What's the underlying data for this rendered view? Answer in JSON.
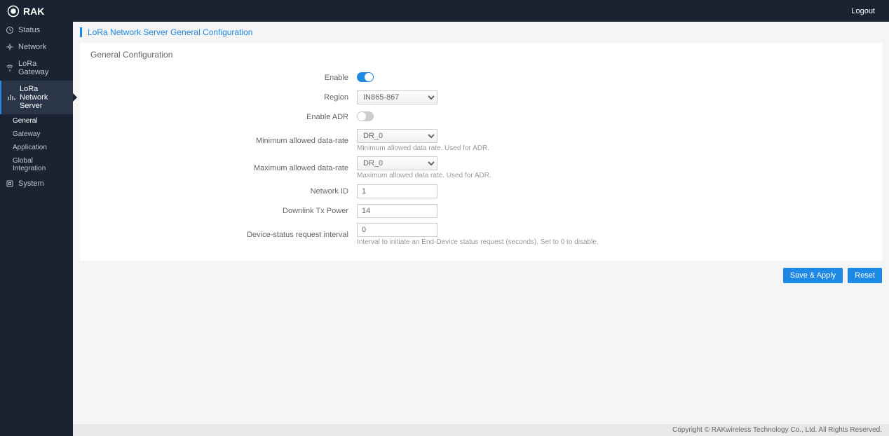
{
  "header": {
    "brand": "RAK",
    "logout": "Logout"
  },
  "sidebar": {
    "items": [
      {
        "label": "Status"
      },
      {
        "label": "Network"
      },
      {
        "label": "LoRa Gateway"
      },
      {
        "label": "LoRa Network Server"
      },
      {
        "label": "System"
      }
    ],
    "subitems": [
      {
        "label": "General"
      },
      {
        "label": "Gateway"
      },
      {
        "label": "Application"
      },
      {
        "label": "Global Integration"
      }
    ]
  },
  "page": {
    "title": "LoRa Network Server General Configuration",
    "subtitle": "General Configuration"
  },
  "form": {
    "enable_label": "Enable",
    "region_label": "Region",
    "region_value": "IN865-867",
    "enable_adr_label": "Enable ADR",
    "min_dr_label": "Minimum allowed data-rate",
    "min_dr_value": "DR_0",
    "min_dr_help": "Minimum allowed data rate. Used for ADR.",
    "max_dr_label": "Maximum allowed data-rate",
    "max_dr_value": "DR_0",
    "max_dr_help": "Maximum allowed data rate. Used for ADR.",
    "network_id_label": "Network ID",
    "network_id_value": "1",
    "downlink_tx_label": "Downlink Tx Power",
    "downlink_tx_value": "14",
    "device_status_label": "Device-status request interval",
    "device_status_value": "0",
    "device_status_help": "Interval to initiate an End-Device status request (seconds). Set to 0 to disable."
  },
  "buttons": {
    "save_apply": "Save & Apply",
    "reset": "Reset"
  },
  "footer": {
    "copyright": "Copyright © RAKwireless Technology Co., Ltd. All Rights Reserved."
  }
}
